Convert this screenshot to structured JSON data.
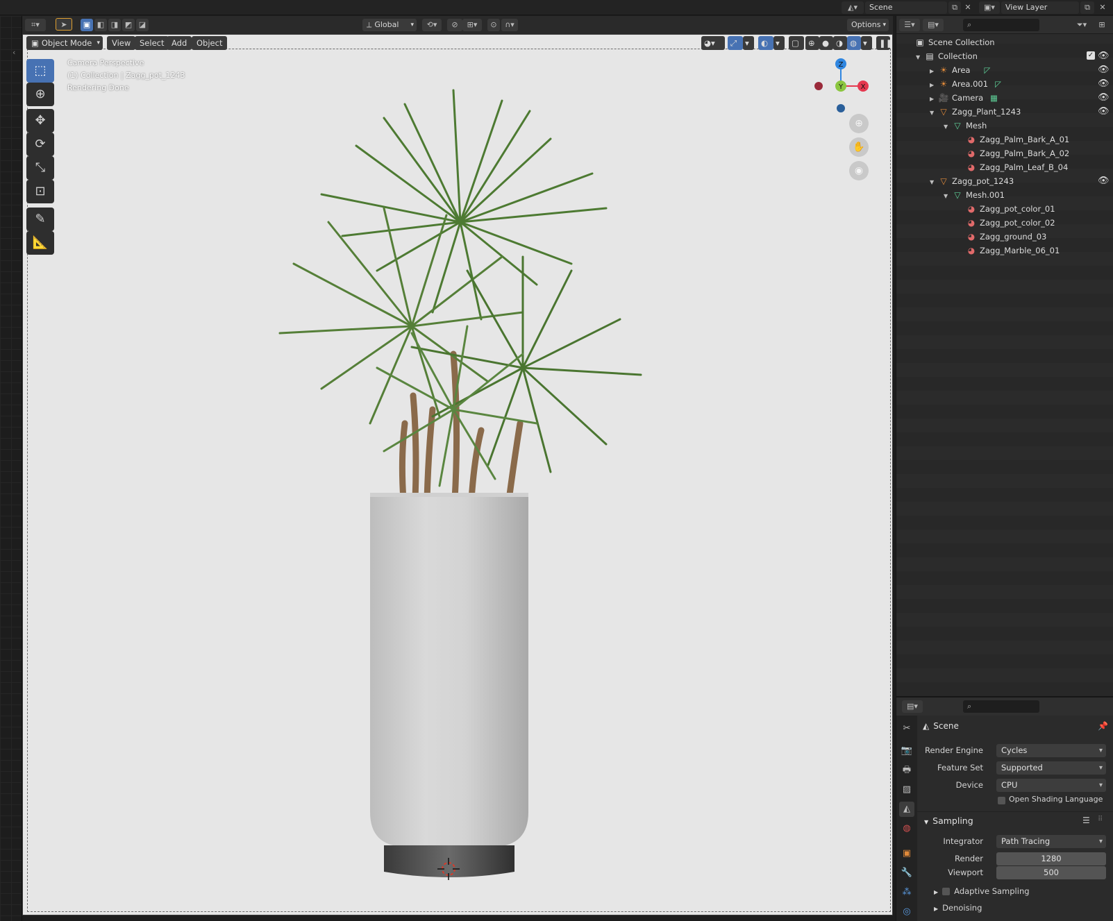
{
  "topbar": {
    "scene_label": "Scene",
    "view_layer_label": "View Layer"
  },
  "viewport_header": {
    "transform_orientation": "Global",
    "options_label": "Options"
  },
  "viewport_menu": {
    "mode": "Object Mode",
    "view": "View",
    "select": "Select",
    "add": "Add",
    "object": "Object"
  },
  "viewport_overlay": {
    "line1": "Camera Perspective",
    "line2": "(1) Collection | Zagg_pot_1243",
    "line3": "Rendering Done"
  },
  "gizmo": {
    "z": "Z",
    "y": "Y",
    "x": "X"
  },
  "outliner": {
    "scene_collection": "Scene Collection",
    "items": [
      {
        "label": "Collection",
        "depth": 0
      },
      {
        "label": "Area",
        "depth": 1
      },
      {
        "label": "Area.001",
        "depth": 1
      },
      {
        "label": "Camera",
        "depth": 1
      },
      {
        "label": "Zagg_Plant_1243",
        "depth": 1
      },
      {
        "label": "Mesh",
        "depth": 2
      },
      {
        "label": "Zagg_Palm_Bark_A_01",
        "depth": 3
      },
      {
        "label": "Zagg_Palm_Bark_A_02",
        "depth": 3
      },
      {
        "label": "Zagg_Palm_Leaf_B_04",
        "depth": 3
      },
      {
        "label": "Zagg_pot_1243",
        "depth": 1
      },
      {
        "label": "Mesh.001",
        "depth": 2
      },
      {
        "label": "Zagg_pot_color_01",
        "depth": 3
      },
      {
        "label": "Zagg_pot_color_02",
        "depth": 3
      },
      {
        "label": "Zagg_ground_03",
        "depth": 3
      },
      {
        "label": "Zagg_Marble_06_01",
        "depth": 3
      }
    ]
  },
  "properties": {
    "context_title": "Scene",
    "render_engine_label": "Render Engine",
    "render_engine_value": "Cycles",
    "feature_set_label": "Feature Set",
    "feature_set_value": "Supported",
    "device_label": "Device",
    "device_value": "CPU",
    "osl_label": "Open Shading Language",
    "sampling_label": "Sampling",
    "integrator_label": "Integrator",
    "integrator_value": "Path Tracing",
    "render_label": "Render",
    "render_value": "1280",
    "viewport_label": "Viewport",
    "viewport_value": "500",
    "adaptive_label": "Adaptive Sampling",
    "denoising_label": "Denoising"
  },
  "colors": {
    "accent": "#4772b3",
    "axis_x": "#e5384f",
    "axis_y": "#8bc63f",
    "axis_z": "#2f86e0",
    "viewport_bg": "#e6e6e6"
  }
}
